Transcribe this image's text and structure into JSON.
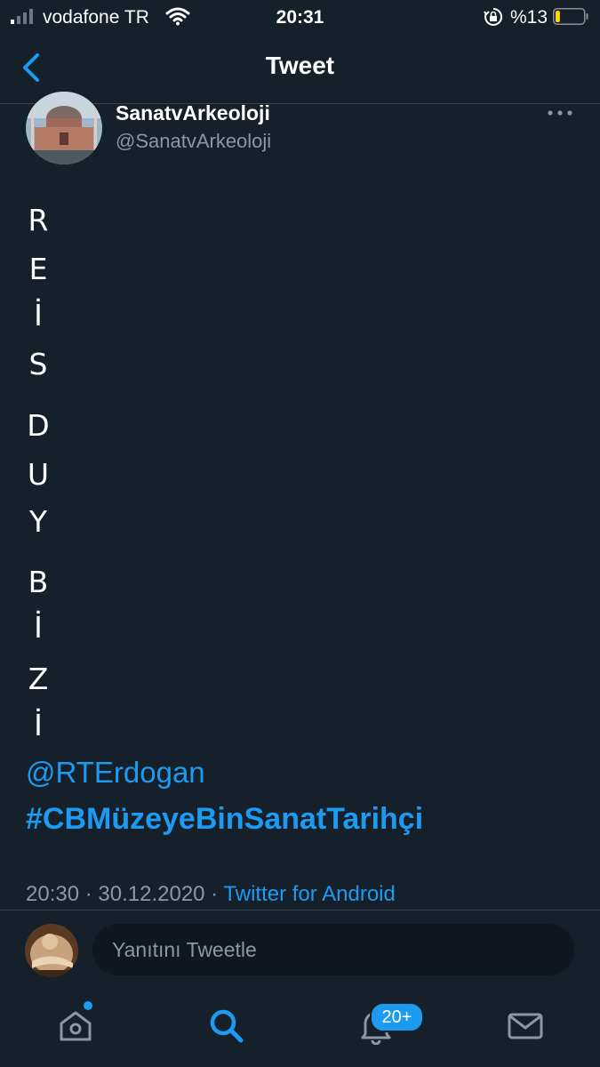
{
  "status_bar": {
    "carrier": "vodafone TR",
    "time": "20:31",
    "battery_percent": "%13",
    "battery_level": 0.13,
    "battery_color": "#ffd60a"
  },
  "header": {
    "title": "Tweet",
    "back_icon": "chevron-left-icon"
  },
  "tweet": {
    "display_name": "SanatvArkeoloji",
    "handle": "@SanatvArkeoloji",
    "letters": [
      "R",
      "E",
      "İ",
      "S",
      "D",
      "U",
      "Y",
      "B",
      "İ",
      "Z",
      "İ"
    ],
    "mention": "@RTErdogan",
    "hashtag": "#CBMüzeyeBinSanatTarihçi",
    "time": "20:30",
    "separator": " · ",
    "date": "30.12.2020",
    "source": "Twitter for Android"
  },
  "reply": {
    "placeholder": "Yanıtını Tweetle"
  },
  "tabbar": {
    "items": [
      "home-icon",
      "search-icon",
      "notifications-icon",
      "messages-icon"
    ],
    "notifications_badge": "20+",
    "active": "search-icon"
  },
  "colors": {
    "background": "#15202b",
    "accent": "#1d9bf0",
    "secondary_text": "#8899a6",
    "divider": "#38444d"
  }
}
